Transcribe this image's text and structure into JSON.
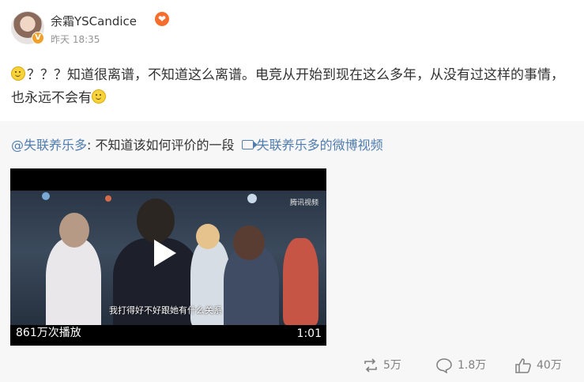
{
  "user": {
    "name": "余霜YSCandice",
    "timestamp": "昨天 18:35",
    "badge": "V"
  },
  "post": {
    "text_parts": [
      "？？？知道很离谱，不知道这么离谱。电竞从开始到现在这么多年，从没有过这样的事情，也永远不会有"
    ]
  },
  "repost": {
    "mention": "@失联养乐多",
    "text": ": 不知道该如何评价的一段",
    "video_link": "失联养乐多的微博视频"
  },
  "video": {
    "views": "861万次播放",
    "duration": "1:01",
    "subtitle": "我打得好不好跟她有什么关系",
    "watermark": "腾讯视频"
  },
  "actions": {
    "repost_count": "5万",
    "comment_count": "1.8万",
    "like_count": "40万"
  },
  "colors": {
    "link": "#507daf",
    "background_repost": "#f7f7f7",
    "vip_badge": "#f66e2d"
  }
}
